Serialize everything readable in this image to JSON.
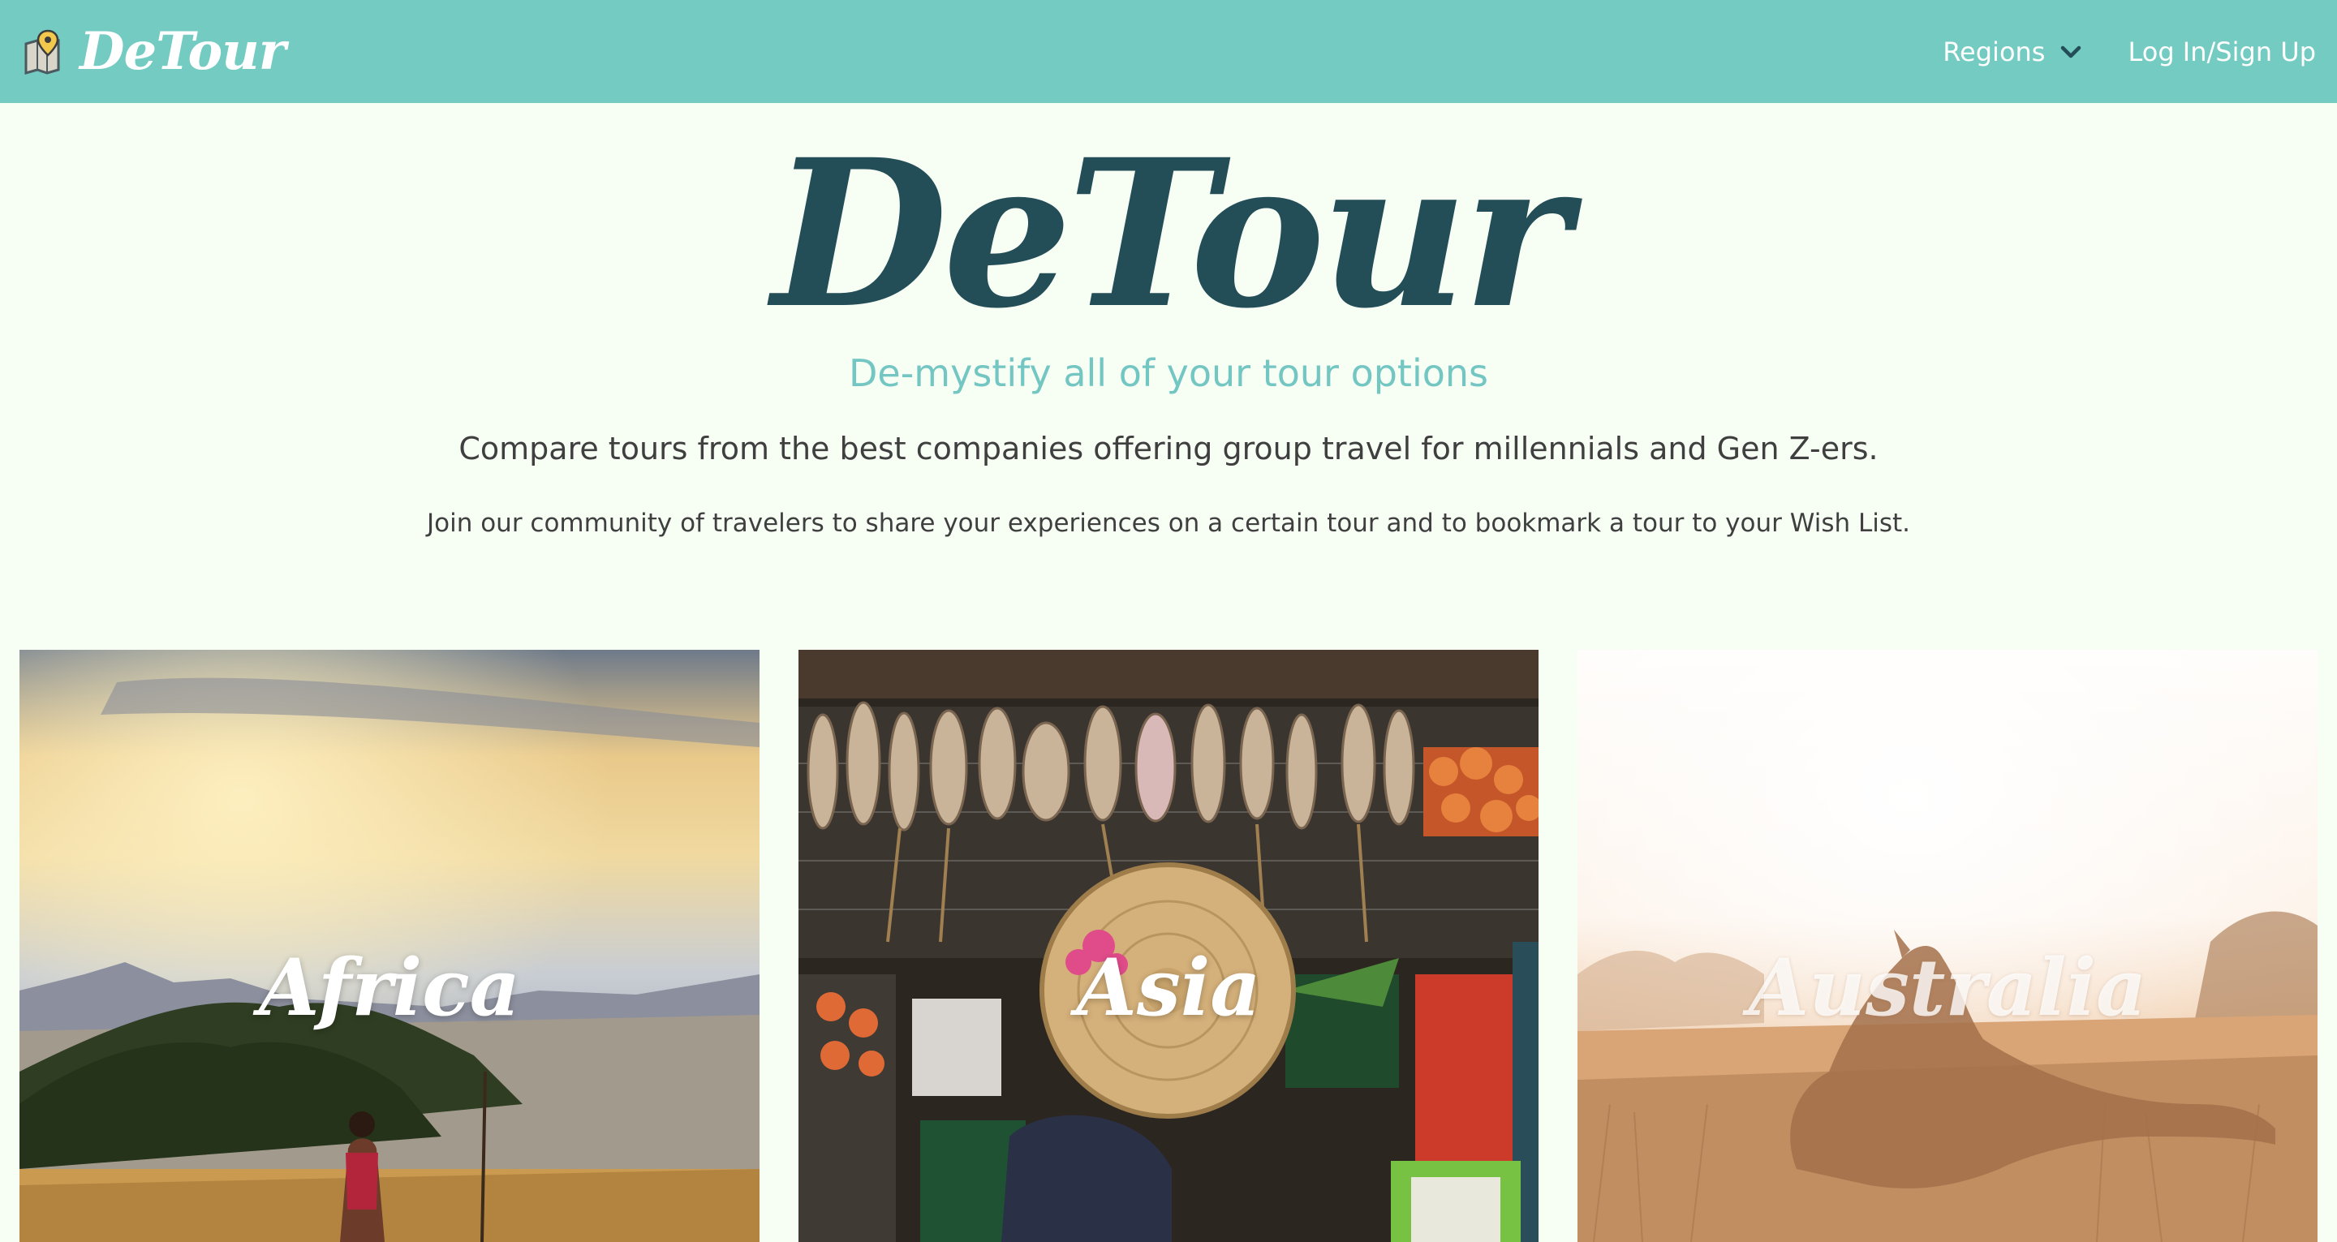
{
  "navbar": {
    "brand": "DeTour",
    "brand_icon": "map-pin-icon",
    "regions_label": "Regions",
    "login_label": "Log In/Sign Up"
  },
  "hero": {
    "title": "DeTour",
    "tagline": "De-mystify all of your tour options",
    "lead": "Compare tours from the best companies offering group travel for millennials and Gen Z-ers.",
    "sub": "Join our community of travelers to share your experiences on a certain tour and to bookmark a tour to your Wish List."
  },
  "regions": [
    {
      "label": "Africa"
    },
    {
      "label": "Asia"
    },
    {
      "label": "Australia"
    }
  ],
  "colors": {
    "navbar": "#73cbc2",
    "title": "#234d57",
    "tagline": "#73c6c2",
    "background": "#f7fff5"
  }
}
